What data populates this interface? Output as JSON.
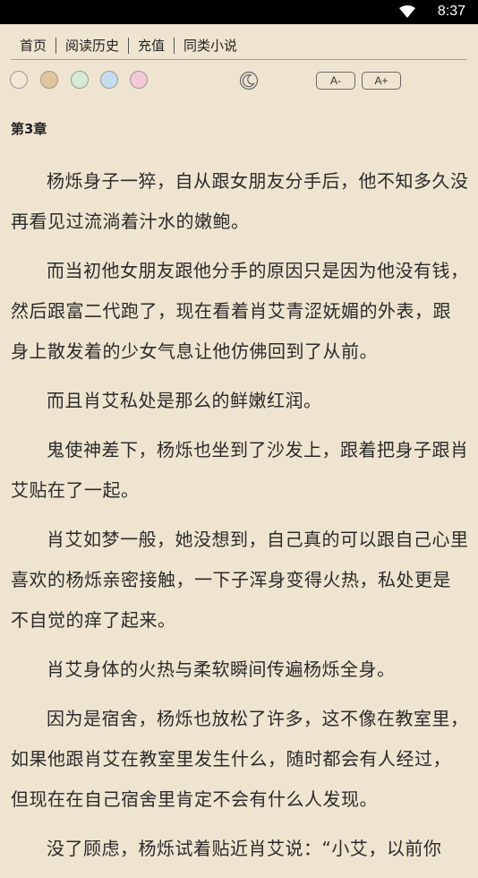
{
  "status": {
    "time": "8:37"
  },
  "nav": [
    {
      "label": "首页"
    },
    {
      "label": "阅读历史"
    },
    {
      "label": "充值"
    },
    {
      "label": "同类小说"
    }
  ],
  "themes": [
    "#f2e6d4",
    "#e2c49d",
    "#d6ead4",
    "#c6ddf0",
    "#f4c9d8"
  ],
  "font_controls": {
    "decrease": "A-",
    "increase": "A+"
  },
  "chapter_title": "第3章",
  "paragraphs": [
    "杨烁身子一猝，自从跟女朋友分手后，他不知多久没再看见过流淌着汁水的嫩鲍。",
    "而当初他女朋友跟他分手的原因只是因为他没有钱，然后跟富二代跑了，现在看着肖艾青涩妩媚的外表，跟身上散发着的少女气息让他仿佛回到了从前。",
    "而且肖艾私处是那么的鲜嫩红润。",
    "鬼使神差下，杨烁也坐到了沙发上，跟着把身子跟肖艾贴在了一起。",
    "肖艾如梦一般，她没想到，自己真的可以跟自己心里喜欢的杨烁亲密接触，一下子浑身变得火热，私处更是不自觉的痒了起来。",
    "肖艾身体的火热与柔软瞬间传遍杨烁全身。",
    "因为是宿舍，杨烁也放松了许多，这不像在教室里，如果他跟肖艾在教室里发生什么，随时都会有人经过，但现在在自己宿舍里肯定不会有什么人发现。",
    "没了顾虑，杨烁试着贴近肖艾说：“小艾，以前你"
  ]
}
